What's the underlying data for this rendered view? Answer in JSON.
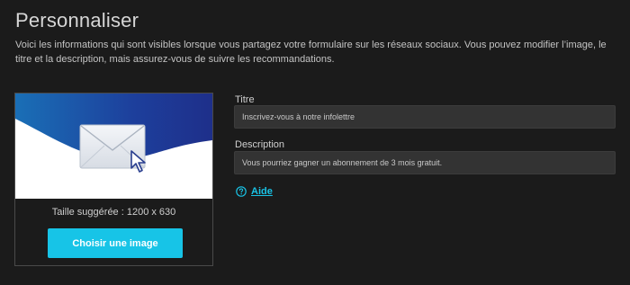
{
  "header": {
    "title": "Personnaliser",
    "intro": "Voici les informations qui sont visibles lorsque vous partagez votre formulaire sur les réseaux sociaux. Vous pouvez modifier l’image, le titre et la description, mais assurez-vous de suivre les recommandations."
  },
  "preview": {
    "image_icon": "envelope-with-cursor",
    "size_hint": "Taille suggérée : 1200 x 630",
    "choose_button_label": "Choisir une image"
  },
  "form": {
    "title_label": "Titre",
    "title_value": "Inscrivez-vous à notre infolettre",
    "description_label": "Description",
    "description_value": "Vous pourriez gagner un abonnement de 3 mois gratuit."
  },
  "help": {
    "icon": "question-circle-icon",
    "label": "Aide"
  },
  "colors": {
    "background": "#1b1b1b",
    "accent": "#17c4e7",
    "input_bg": "#333333",
    "banner_blue": "#1e4fa8"
  }
}
